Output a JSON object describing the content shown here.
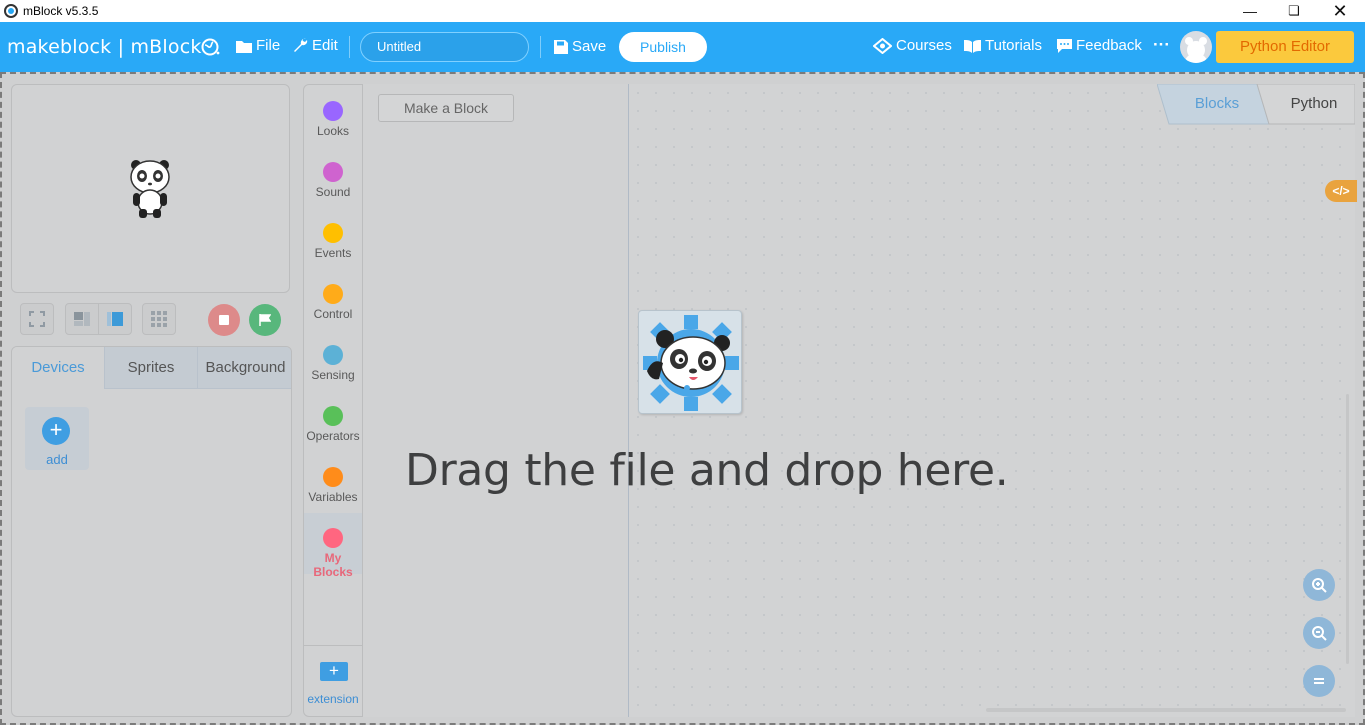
{
  "window": {
    "title": "mBlock v5.3.5"
  },
  "menubar": {
    "brand": "makeblock | mBlock",
    "file_label": "File",
    "edit_label": "Edit",
    "project_title": "Untitled",
    "save_label": "Save",
    "publish_label": "Publish",
    "courses_label": "Courses",
    "tutorials_label": "Tutorials",
    "feedback_label": "Feedback",
    "more_label": "···",
    "python_editor_label": "Python Editor"
  },
  "sprite_panel": {
    "tabs": [
      "Devices",
      "Sprites",
      "Background"
    ],
    "active_tab": "Devices",
    "add_label": "add"
  },
  "categories": {
    "items": [
      {
        "label": "Looks",
        "color": "#9966ff"
      },
      {
        "label": "Sound",
        "color": "#cf63cf"
      },
      {
        "label": "Events",
        "color": "#ffbf00"
      },
      {
        "label": "Control",
        "color": "#ffab19"
      },
      {
        "label": "Sensing",
        "color": "#5cb1d6"
      },
      {
        "label": "Operators",
        "color": "#59c059"
      },
      {
        "label": "Variables",
        "color": "#ff8c1a"
      },
      {
        "label": "My Blocks",
        "color": "#ff6680"
      }
    ],
    "active": "My Blocks",
    "extension_label": "extension"
  },
  "palette": {
    "make_block_label": "Make a Block"
  },
  "code_tabs": {
    "blocks_label": "Blocks",
    "python_label": "Python",
    "active": "Blocks"
  },
  "drop_overlay": {
    "message": "Drag the file and drop here."
  },
  "colors": {
    "accent": "#29a9f7",
    "python_editor_bg": "#fbc93d",
    "active_category": "#e8687a"
  }
}
